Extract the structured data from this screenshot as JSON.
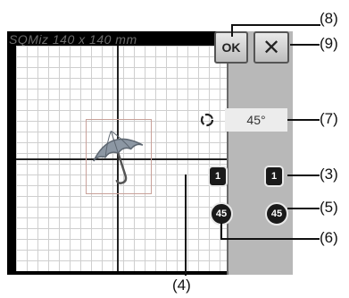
{
  "screen": {
    "size_title": "SQMiz 140 x 140 mm"
  },
  "buttons": {
    "ok_label": "OK",
    "close_label": "✕"
  },
  "rotation": {
    "angle_value": "45°",
    "rotate_1_left_label": "1",
    "rotate_1_right_label": "1",
    "rotate_45_left_label": "45",
    "rotate_45_right_label": "45"
  },
  "callouts": {
    "c3": "(3)",
    "c4": "(4)",
    "c5": "(5)",
    "c6": "(6)",
    "c7": "(7)",
    "c8": "(8)",
    "c9": "(9)"
  },
  "icons": {
    "design": "umbrella-icon",
    "rotate": "rotate-icon"
  }
}
